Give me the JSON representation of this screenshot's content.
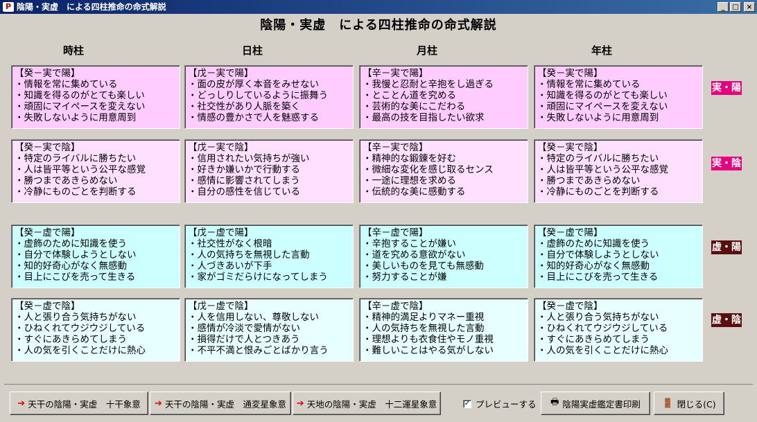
{
  "window": {
    "title": "陰陽・実虚　による四柱推命の命式解説",
    "controls": [
      "_",
      "□",
      "×"
    ]
  },
  "page_title": "陰陽・実虚　による四柱推命の命式解説",
  "columns": [
    "時柱",
    "日柱",
    "月柱",
    "年柱"
  ],
  "rows": [
    {
      "label": "実・陽",
      "cells": [
        [
          "【癸－実で陽】",
          "・情報を常に集めている",
          "・知識を得るのがとても楽しい",
          "・頑固にマイペースを変えない",
          "・失敗しないように用意周到"
        ],
        [
          "【戊－実で陽】",
          "・面の皮が厚く本音をみせない",
          "・どっしりしているように振舞う",
          "・社交性があり人脈を築く",
          "・情感の豊かさで人を魅惑する"
        ],
        [
          "【辛－実で陽】",
          "・我慢と忍耐と辛抱をし過ぎる",
          "・とことん道を究める",
          "・芸術的な美にこだわる",
          "・最高の技を目指したい欲求"
        ],
        [
          "【癸－実で陽】",
          "・情報を常に集めている",
          "・知識を得るのがとても楽しい",
          "・頑固にマイペースを変えない",
          "・失敗しないように用意周到"
        ]
      ]
    },
    {
      "label": "実・陰",
      "cells": [
        [
          "【癸－実で陰】",
          "・特定のライバルに勝ちたい",
          "・人は皆平等という公平な感覚",
          "・勝つまであきらめない",
          "・冷静にものごとを判断する"
        ],
        [
          "【戊－実で陰】",
          "・信用されたい気持ちが強い",
          "・好きか嫌いかで行動する",
          "・感情に影響されてしまう",
          "・自分の感性を信じている"
        ],
        [
          "【辛－実で陰】",
          "・精神的な鍛錬を好む",
          "・微細な変化を感じ取るセンス",
          "・一途に理想を求める",
          "・伝統的な美に感動する"
        ],
        [
          "【癸－実で陰】",
          "・特定のライバルに勝ちたい",
          "・人は皆平等という公平な感覚",
          "・勝つまであきらめない",
          "・冷静にものごとを判断する"
        ]
      ]
    },
    {
      "label": "虚・陽",
      "cells": [
        [
          "【癸－虚で陽】",
          "・虚飾のために知識を使う",
          "・自分で体験しようとしない",
          "・知的好奇心がなく無感動",
          "・目上にこびを売って生きる"
        ],
        [
          "【戊－虚で陽】",
          "・社交性がなく根暗",
          "・人の気持ちを無視した言動",
          "・人づきあいが下手",
          "・家がゴミだらけになってしまう"
        ],
        [
          "【辛－虚で陽】",
          "・辛抱することが嫌い",
          "・道を究める意欲がない",
          "・美しいものを見ても無感動",
          "・努力することが嫌"
        ],
        [
          "【癸－虚で陽】",
          "・虚飾のために知識を使う",
          "・自分で体験しようとしない",
          "・知的好奇心がなく無感動",
          "・目上にこびを売って生きる"
        ]
      ]
    },
    {
      "label": "虚・陰",
      "cells": [
        [
          "【癸－虚で陰】",
          "・人と張り合う気持ちがない",
          "・ひねくれてウジウジしている",
          "・すぐにあきらめてしまう",
          "・人の気を引くことだけに熱心"
        ],
        [
          "【戊－虚で陰】",
          "・人を信用しない、尊敬しない",
          "・感情が冷淡で愛情がない",
          "・損得だけで人とつきあう",
          "・不平不満と恨みごとばかり言う"
        ],
        [
          "【辛－虚で陰】",
          "・精神的満足よりマネー重視",
          "・人の気持ちを無視した言動",
          "・理想よりも衣食住やモノ重視",
          "・難しいことはやる気がしない"
        ],
        [
          "【癸－虚で陰】",
          "・人と張り合う気持ちがない",
          "・ひねくれてウジウジしている",
          "・すぐにあきらめてしまう",
          "・人の気を引くことだけに熱心"
        ]
      ]
    }
  ],
  "buttons": {
    "b1": "天干の陰陽・実虚　十干象意",
    "b2": "天干の陰陽・実虚　通変星象意",
    "b3": "天地の陰陽・実虚　十二運星象意",
    "preview": "プレビューする",
    "print": "陰陽実虚鑑定書印刷",
    "close": "閉じる(C)"
  },
  "preview_checked": true,
  "colors": {
    "pink": "#ffccff",
    "light_pink": "#ffe1ff",
    "cyan": "#ccffff",
    "light_cyan": "#e8ffff",
    "label_pink": "#e6007e",
    "label_dark": "#5a0f0f"
  }
}
